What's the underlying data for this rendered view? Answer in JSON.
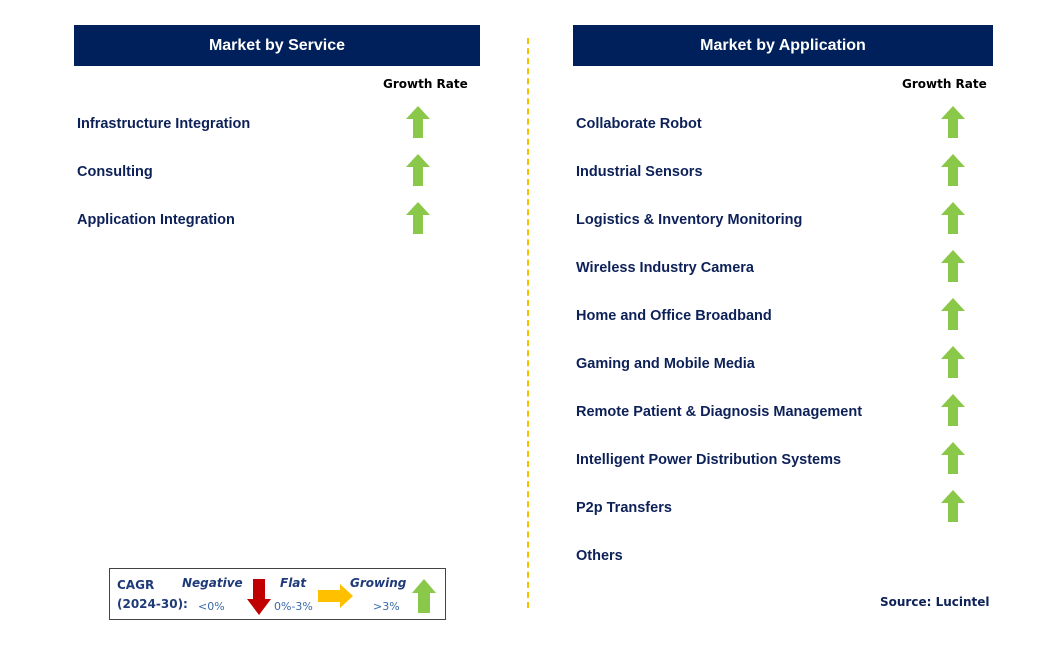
{
  "left_panel": {
    "title": "Market by Service",
    "growth_rate_label": "Growth Rate",
    "items": [
      {
        "label": "Infrastructure Integration",
        "trend": "growing"
      },
      {
        "label": "Consulting",
        "trend": "growing"
      },
      {
        "label": "Application Integration",
        "trend": "growing"
      }
    ]
  },
  "right_panel": {
    "title": "Market by Application",
    "growth_rate_label": "Growth Rate",
    "items": [
      {
        "label": "Collaborate Robot",
        "trend": "growing"
      },
      {
        "label": "Industrial Sensors",
        "trend": "growing"
      },
      {
        "label": "Logistics & Inventory Monitoring",
        "trend": "growing"
      },
      {
        "label": "Wireless Industry Camera",
        "trend": "growing"
      },
      {
        "label": "Home and Office Broadband",
        "trend": "growing"
      },
      {
        "label": "Gaming and Mobile Media",
        "trend": "growing"
      },
      {
        "label": "Remote Patient & Diagnosis Management",
        "trend": "growing"
      },
      {
        "label": "Intelligent Power Distribution Systems",
        "trend": "growing"
      },
      {
        "label": "P2p Transfers",
        "trend": "growing"
      },
      {
        "label": "Others",
        "trend": "none"
      }
    ]
  },
  "legend": {
    "title_line1": "CAGR",
    "title_line2": "(2024-30):",
    "negative_label": "Negative",
    "negative_range": "<0%",
    "flat_label": "Flat",
    "flat_range": "0%-3%",
    "growing_label": "Growing",
    "growing_range": ">3%"
  },
  "source": "Source: Lucintel",
  "colors": {
    "header_bg": "#00205b",
    "growing_arrow": "#8ac849",
    "flat_arrow": "#ffc000",
    "negative_arrow": "#c00000",
    "divider": "#f5c000",
    "item_text": "#0d2158"
  }
}
